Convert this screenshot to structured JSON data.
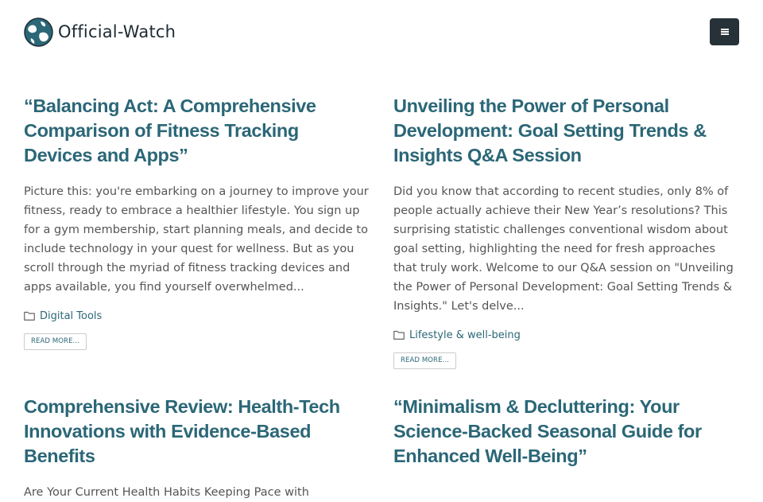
{
  "site": {
    "name": "Official-Watch",
    "brand_color": "#2b6777",
    "menu_button_color": "#273138",
    "menu_icon": "hamburger-menu-icon",
    "logo_icon": "globe-logo-icon"
  },
  "posts": [
    {
      "title": "“Balancing Act: A Comprehensive Comparison of Fitness Tracking Devices and Apps”",
      "excerpt": "Picture this: you're embarking on a journey to improve your fitness, ready to embrace a healthier lifestyle. You sign up for a gym membership, start planning meals, and decide to include technology in your quest for wellness. But as you scroll through the myriad of fitness tracking devices and apps available, you find yourself overwhelmed...",
      "category": "Digital Tools",
      "category_icon": "folder-icon",
      "read_more": "READ MORE..."
    },
    {
      "title": "Unveiling the Power of Personal Development: Goal Setting Trends & Insights Q&A Session",
      "excerpt": "Did you know that according to recent studies, only 8% of people actually achieve their New Year’s resolutions? This surprising statistic challenges conventional wisdom about goal setting, highlighting the need for fresh approaches that truly work. Welcome to our Q&A session on \"Unveiling the Power of Personal Development: Goal Setting Trends & Insights.\" Let's delve...",
      "category": "Lifestyle & well-being",
      "category_icon": "folder-icon",
      "read_more": "READ MORE..."
    },
    {
      "title": "Comprehensive Review: Health-Tech Innovations with Evidence-Based Benefits",
      "excerpt": "Are Your Current Health Habits Keeping Pace with"
    },
    {
      "title": "“Minimalism & Decluttering: Your Science-Backed Seasonal Guide for Enhanced Well-Being”"
    }
  ]
}
